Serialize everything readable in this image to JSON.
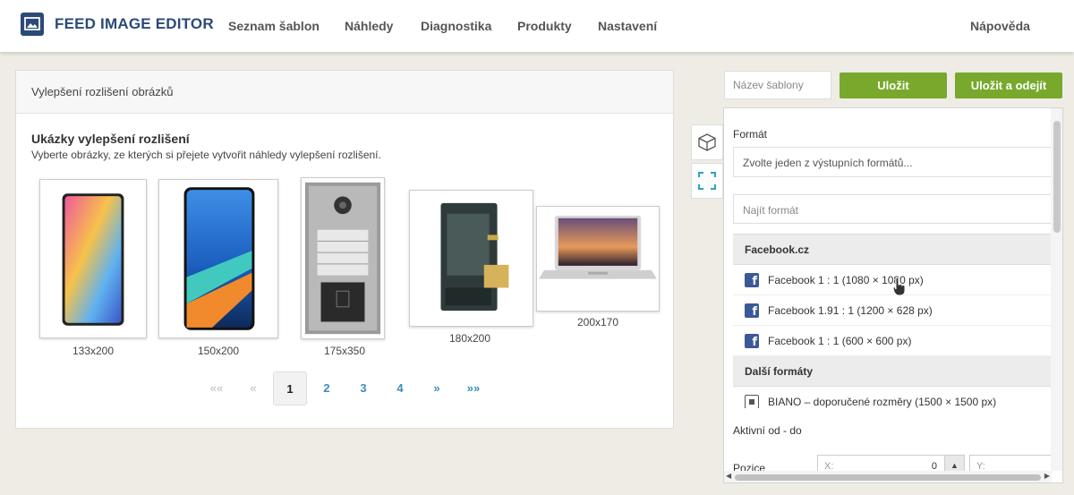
{
  "header": {
    "logo_text": "FEED IMAGE EDITOR",
    "nav": [
      "Seznam šablon",
      "Náhledy",
      "Diagnostika",
      "Produkty",
      "Nastavení"
    ],
    "help": "Nápověda"
  },
  "card": {
    "header_title": "Vylepšení rozlišení obrázků",
    "section_title": "Ukázky vylepšení rozlišení",
    "section_desc": "Vyberte obrázky, ze kterých si přejete vytvořit náhledy vylepšení rozlišení.",
    "thumbnails": [
      {
        "label": "133x200",
        "icon": "phone-gradient"
      },
      {
        "label": "150x200",
        "icon": "phone-blue"
      },
      {
        "label": "175x350",
        "icon": "intercom-panel"
      },
      {
        "label": "180x200",
        "icon": "battery"
      },
      {
        "label": "200x170",
        "icon": "laptop"
      }
    ],
    "pagination": {
      "first": "««",
      "prev": "«",
      "pages": [
        "1",
        "2",
        "3",
        "4"
      ],
      "current": "1",
      "next": "»",
      "last": "»»"
    }
  },
  "right": {
    "name_placeholder": "Název šablony",
    "save": "Uložit",
    "save_exit": "Uložit a odejít",
    "format_label": "Formát",
    "format_select": "Zvolte jeden z výstupních formátů...",
    "format_search_placeholder": "Najít formát",
    "groups": [
      {
        "name": "Facebook.cz",
        "items": [
          {
            "label": "Facebook 1 : 1 (1080 × 1080 px)",
            "icon": "facebook-icon"
          },
          {
            "label": "Facebook 1.91 : 1 (1200 × 628 px)",
            "icon": "facebook-icon"
          },
          {
            "label": "Facebook 1 : 1 (600 × 600 px)",
            "icon": "facebook-icon"
          }
        ]
      },
      {
        "name": "Další formáty",
        "items": [
          {
            "label": "BIANO – doporučené rozměry (1500 × 1500 px)",
            "icon": "biano-icon"
          }
        ]
      }
    ],
    "active_label": "Aktivní od - do",
    "position_label": "Pozice",
    "pos_x_prefix": "X:",
    "pos_x_value": "0",
    "pos_y_prefix": "Y:"
  },
  "colors": {
    "brand": "#2c4a78",
    "accent_green": "#78a92c",
    "link": "#3a8fb7",
    "facebook": "#3b5998",
    "background": "#efece6"
  }
}
